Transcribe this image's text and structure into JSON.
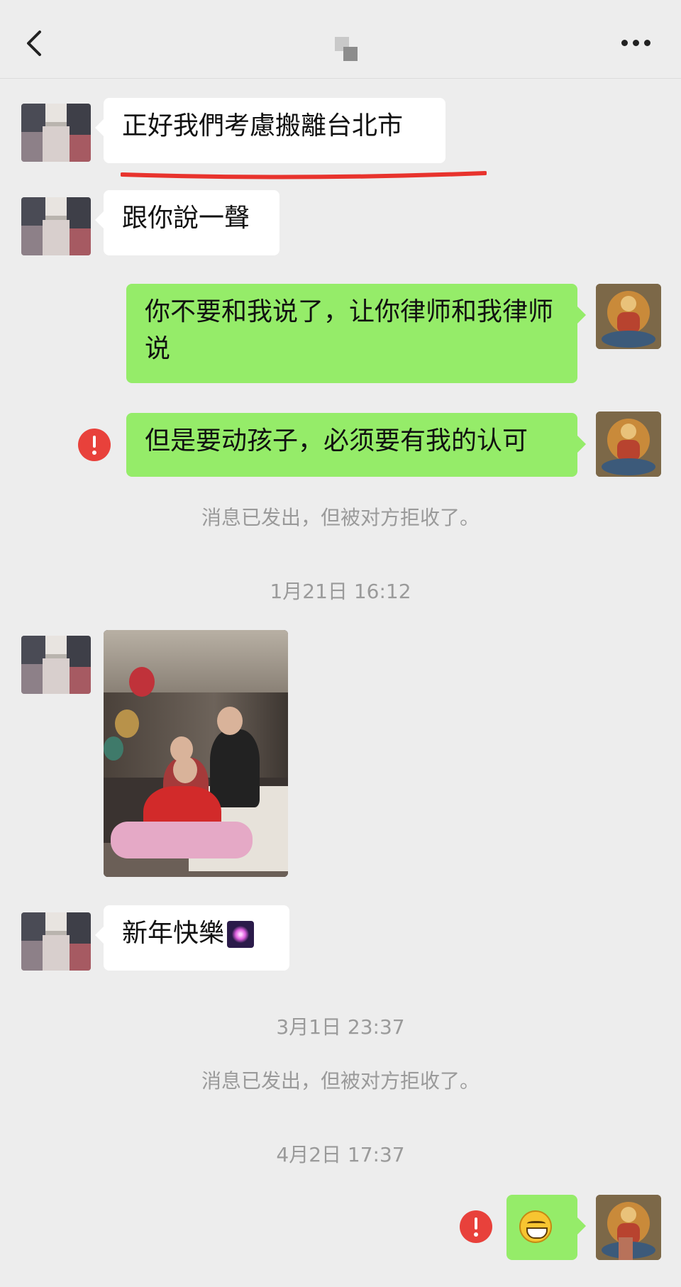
{
  "header": {
    "back_icon": "chevron-left-icon",
    "more_icon": "more-dots-icon"
  },
  "messages": [
    {
      "side": "in",
      "text": "正好我們考慮搬離台北市",
      "underline_color": "#e8332d"
    },
    {
      "side": "in",
      "text": "跟你說一聲"
    },
    {
      "side": "out",
      "text": "你不要和我说了，让你律师和我律师说"
    },
    {
      "side": "out",
      "text": "但是要动孩子，必须要有我的认可",
      "failed": true
    },
    {
      "side": "in",
      "type": "image",
      "description": "family-photo"
    },
    {
      "side": "in",
      "text": "新年快樂",
      "emoji": "firework-icon"
    },
    {
      "side": "out",
      "type": "emoji",
      "emoji": "grin-emoji-icon",
      "failed": true
    }
  ],
  "system": {
    "rejected_1": "消息已发出，但被对方拒收了。",
    "time_1": "1月21日 16:12",
    "time_2": "3月1日 23:37",
    "rejected_2": "消息已发出，但被对方拒收了。",
    "time_3": "4月2日 17:37"
  },
  "colors": {
    "background": "#ededed",
    "incoming_bubble": "#ffffff",
    "outgoing_bubble": "#95ec69",
    "error_icon": "#e8413b",
    "system_text": "#9a9a9a"
  }
}
